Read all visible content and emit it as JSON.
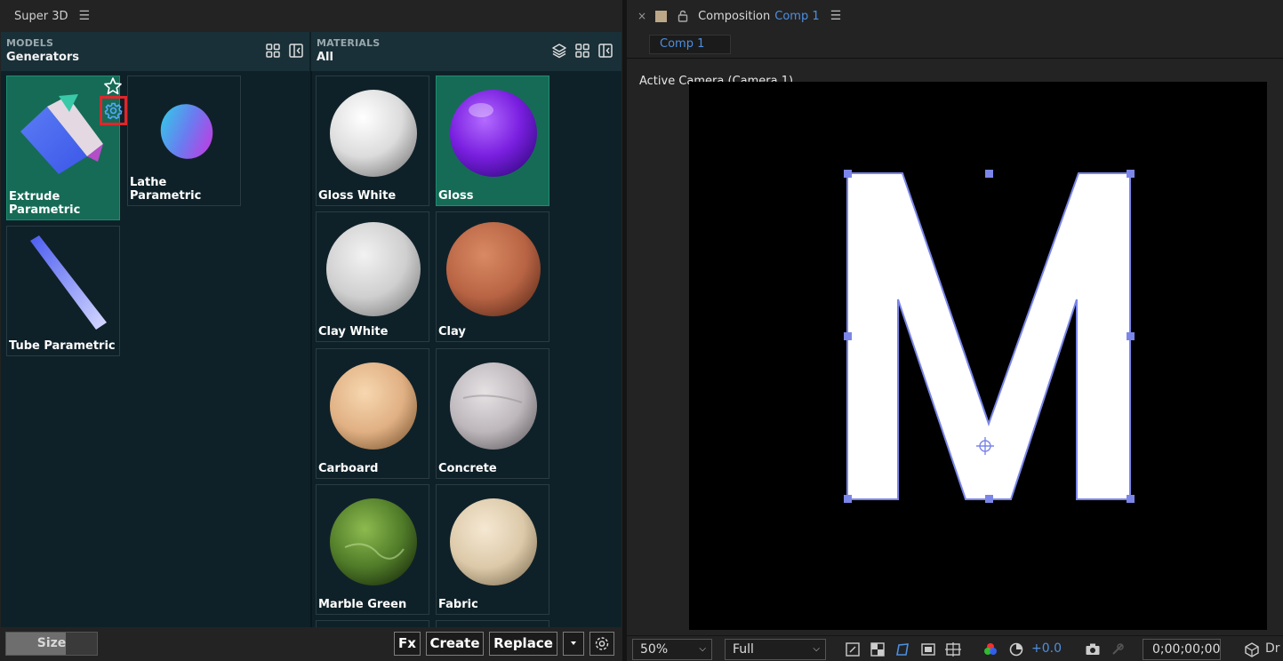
{
  "left_panel": {
    "title": "Super 3D",
    "models": {
      "caption": "MODELS",
      "subtitle": "Generators",
      "items": [
        {
          "label": "Extrude Parametric"
        },
        {
          "label": "Lathe Parametric"
        },
        {
          "label": "Tube Parametric"
        }
      ]
    },
    "materials": {
      "caption": "MATERIALS",
      "subtitle": "All",
      "items": [
        {
          "label": "Gloss White"
        },
        {
          "label": "Gloss"
        },
        {
          "label": "Clay White"
        },
        {
          "label": "Clay"
        },
        {
          "label": "Carboard"
        },
        {
          "label": "Concrete"
        },
        {
          "label": "Marble Green"
        },
        {
          "label": "Fabric"
        }
      ]
    },
    "bottom": {
      "size_label": "Size",
      "size_level": 0.66,
      "fx_label": "Fx",
      "create_label": "Create",
      "replace_label": "Replace"
    }
  },
  "right_panel": {
    "panel_title": "Composition",
    "comp_name": "Comp 1",
    "tab_label": "Comp 1",
    "camera_label": "Active Camera (Camera 1)",
    "letter": "M",
    "zoom": "50%",
    "resolution": "Full",
    "exposure": "+0.0",
    "timecode": "0;00;00;00",
    "renderer_label": "Dr"
  },
  "colors": {
    "accent_blue": "#4d8fe0",
    "selected_card": "#166b56",
    "handle": "#7b86e8",
    "panel_bg": "#0f2128"
  }
}
